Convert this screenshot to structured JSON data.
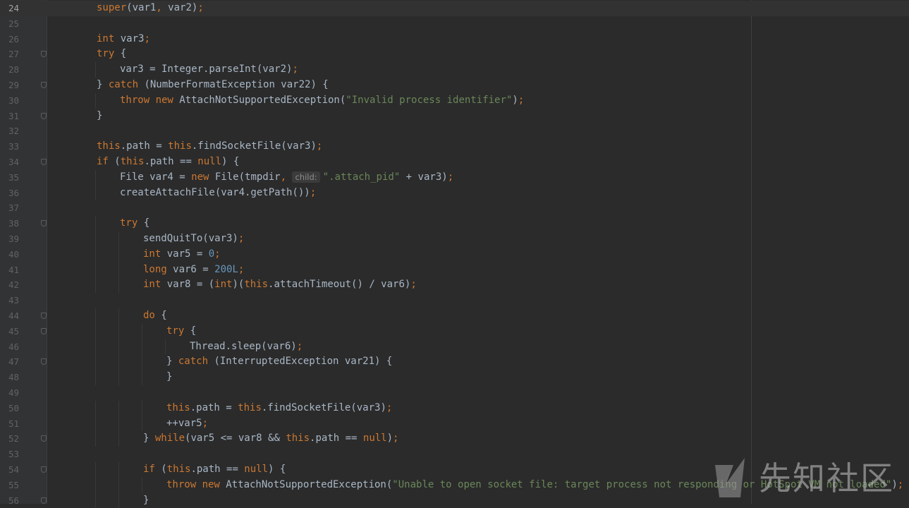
{
  "editor": {
    "current_line": 24,
    "lines": [
      {
        "n": "24",
        "indent": 1,
        "fold": false,
        "current": true,
        "tokens": [
          [
            "kw",
            "super"
          ],
          [
            "p",
            "(var1"
          ],
          [
            "kw",
            ","
          ],
          [
            "p",
            " var2)"
          ],
          [
            "kw",
            ";"
          ]
        ]
      },
      {
        "n": "25",
        "indent": 0,
        "fold": false,
        "tokens": []
      },
      {
        "n": "26",
        "indent": 1,
        "fold": false,
        "tokens": [
          [
            "kw",
            "int"
          ],
          [
            "p",
            " var3"
          ],
          [
            "kw",
            ";"
          ]
        ]
      },
      {
        "n": "27",
        "indent": 1,
        "fold": true,
        "tokens": [
          [
            "kw",
            "try"
          ],
          [
            "p",
            " {"
          ]
        ]
      },
      {
        "n": "28",
        "indent": 2,
        "fold": false,
        "tokens": [
          [
            "p",
            "var3 = Integer.parseInt(var2)"
          ],
          [
            "kw",
            ";"
          ]
        ]
      },
      {
        "n": "29",
        "indent": 1,
        "fold": true,
        "tokens": [
          [
            "p",
            "} "
          ],
          [
            "kw",
            "catch"
          ],
          [
            "p",
            " (NumberFormatException var22) {"
          ]
        ]
      },
      {
        "n": "30",
        "indent": 2,
        "fold": false,
        "tokens": [
          [
            "kw",
            "throw new"
          ],
          [
            "p",
            " AttachNotSupportedException("
          ],
          [
            "str",
            "\"Invalid process identifier\""
          ],
          [
            "p",
            ")"
          ],
          [
            "kw",
            ";"
          ]
        ]
      },
      {
        "n": "31",
        "indent": 1,
        "fold": true,
        "tokens": [
          [
            "p",
            "}"
          ]
        ]
      },
      {
        "n": "32",
        "indent": 0,
        "fold": false,
        "tokens": []
      },
      {
        "n": "33",
        "indent": 1,
        "fold": false,
        "tokens": [
          [
            "kw",
            "this"
          ],
          [
            "p",
            ".path = "
          ],
          [
            "kw",
            "this"
          ],
          [
            "p",
            ".findSocketFile(var3)"
          ],
          [
            "kw",
            ";"
          ]
        ]
      },
      {
        "n": "34",
        "indent": 1,
        "fold": true,
        "tokens": [
          [
            "kw",
            "if"
          ],
          [
            "p",
            " ("
          ],
          [
            "kw",
            "this"
          ],
          [
            "p",
            ".path == "
          ],
          [
            "kw",
            "null"
          ],
          [
            "p",
            ") {"
          ]
        ]
      },
      {
        "n": "35",
        "indent": 2,
        "fold": false,
        "tokens": [
          [
            "p",
            "File var4 = "
          ],
          [
            "kw",
            "new"
          ],
          [
            "p",
            " File(tmpdir"
          ],
          [
            "kw",
            ","
          ],
          [
            "p",
            " "
          ],
          [
            "hint",
            "child:"
          ],
          [
            "str",
            "\".attach_pid\""
          ],
          [
            "p",
            " + var3)"
          ],
          [
            "kw",
            ";"
          ]
        ]
      },
      {
        "n": "36",
        "indent": 2,
        "fold": false,
        "tokens": [
          [
            "p",
            "createAttachFile(var4.getPath())"
          ],
          [
            "kw",
            ";"
          ]
        ]
      },
      {
        "n": "37",
        "indent": 0,
        "fold": false,
        "tokens": []
      },
      {
        "n": "38",
        "indent": 2,
        "fold": true,
        "tokens": [
          [
            "kw",
            "try"
          ],
          [
            "p",
            " {"
          ]
        ]
      },
      {
        "n": "39",
        "indent": 3,
        "fold": false,
        "tokens": [
          [
            "p",
            "sendQuitTo(var3)"
          ],
          [
            "kw",
            ";"
          ]
        ]
      },
      {
        "n": "40",
        "indent": 3,
        "fold": false,
        "tokens": [
          [
            "kw",
            "int"
          ],
          [
            "p",
            " var5 = "
          ],
          [
            "num",
            "0"
          ],
          [
            "kw",
            ";"
          ]
        ]
      },
      {
        "n": "41",
        "indent": 3,
        "fold": false,
        "tokens": [
          [
            "kw",
            "long"
          ],
          [
            "p",
            " var6 = "
          ],
          [
            "num",
            "200L"
          ],
          [
            "kw",
            ";"
          ]
        ]
      },
      {
        "n": "42",
        "indent": 3,
        "fold": false,
        "tokens": [
          [
            "kw",
            "int"
          ],
          [
            "p",
            " var8 = ("
          ],
          [
            "kw",
            "int"
          ],
          [
            "p",
            ")("
          ],
          [
            "kw",
            "this"
          ],
          [
            "p",
            ".attachTimeout() / var6)"
          ],
          [
            "kw",
            ";"
          ]
        ]
      },
      {
        "n": "43",
        "indent": 0,
        "fold": false,
        "tokens": []
      },
      {
        "n": "44",
        "indent": 3,
        "fold": true,
        "tokens": [
          [
            "kw",
            "do"
          ],
          [
            "p",
            " {"
          ]
        ]
      },
      {
        "n": "45",
        "indent": 4,
        "fold": true,
        "tokens": [
          [
            "kw",
            "try"
          ],
          [
            "p",
            " {"
          ]
        ]
      },
      {
        "n": "46",
        "indent": 5,
        "fold": false,
        "tokens": [
          [
            "p",
            "Thread.sleep(var6)"
          ],
          [
            "kw",
            ";"
          ]
        ]
      },
      {
        "n": "47",
        "indent": 4,
        "fold": true,
        "tokens": [
          [
            "p",
            "} "
          ],
          [
            "kw",
            "catch"
          ],
          [
            "p",
            " (InterruptedException var21) {"
          ]
        ]
      },
      {
        "n": "48",
        "indent": 4,
        "fold": false,
        "tokens": [
          [
            "p",
            "}"
          ]
        ]
      },
      {
        "n": "49",
        "indent": 0,
        "fold": false,
        "tokens": []
      },
      {
        "n": "50",
        "indent": 4,
        "fold": false,
        "tokens": [
          [
            "kw",
            "this"
          ],
          [
            "p",
            ".path = "
          ],
          [
            "kw",
            "this"
          ],
          [
            "p",
            ".findSocketFile(var3)"
          ],
          [
            "kw",
            ";"
          ]
        ]
      },
      {
        "n": "51",
        "indent": 4,
        "fold": false,
        "tokens": [
          [
            "p",
            "++var5"
          ],
          [
            "kw",
            ";"
          ]
        ]
      },
      {
        "n": "52",
        "indent": 3,
        "fold": true,
        "tokens": [
          [
            "p",
            "} "
          ],
          [
            "kw",
            "while"
          ],
          [
            "p",
            "(var5 <= var8 && "
          ],
          [
            "kw",
            "this"
          ],
          [
            "p",
            ".path == "
          ],
          [
            "kw",
            "null"
          ],
          [
            "p",
            ")"
          ],
          [
            "kw",
            ";"
          ]
        ]
      },
      {
        "n": "53",
        "indent": 0,
        "fold": false,
        "tokens": []
      },
      {
        "n": "54",
        "indent": 3,
        "fold": true,
        "tokens": [
          [
            "kw",
            "if"
          ],
          [
            "p",
            " ("
          ],
          [
            "kw",
            "this"
          ],
          [
            "p",
            ".path == "
          ],
          [
            "kw",
            "null"
          ],
          [
            "p",
            ") {"
          ]
        ]
      },
      {
        "n": "55",
        "indent": 4,
        "fold": false,
        "tokens": [
          [
            "kw",
            "throw new"
          ],
          [
            "p",
            " AttachNotSupportedException("
          ],
          [
            "str",
            "\"Unable to open socket file: target process not responding or HotSpot VM not loaded\""
          ],
          [
            "p",
            ")"
          ],
          [
            "kw",
            ";"
          ]
        ]
      },
      {
        "n": "56",
        "indent": 3,
        "fold": true,
        "tokens": [
          [
            "p",
            "}"
          ]
        ]
      }
    ]
  },
  "watermark": {
    "text": "先知社区",
    "logo_icon": "xianzhi-logo-icon"
  },
  "colors": {
    "background": "#2b2b2b",
    "gutter": "#313335",
    "keyword": "#cc7832",
    "string": "#6a8759",
    "number": "#6897bb",
    "text": "#a9b7c6",
    "line_number": "#606366"
  }
}
